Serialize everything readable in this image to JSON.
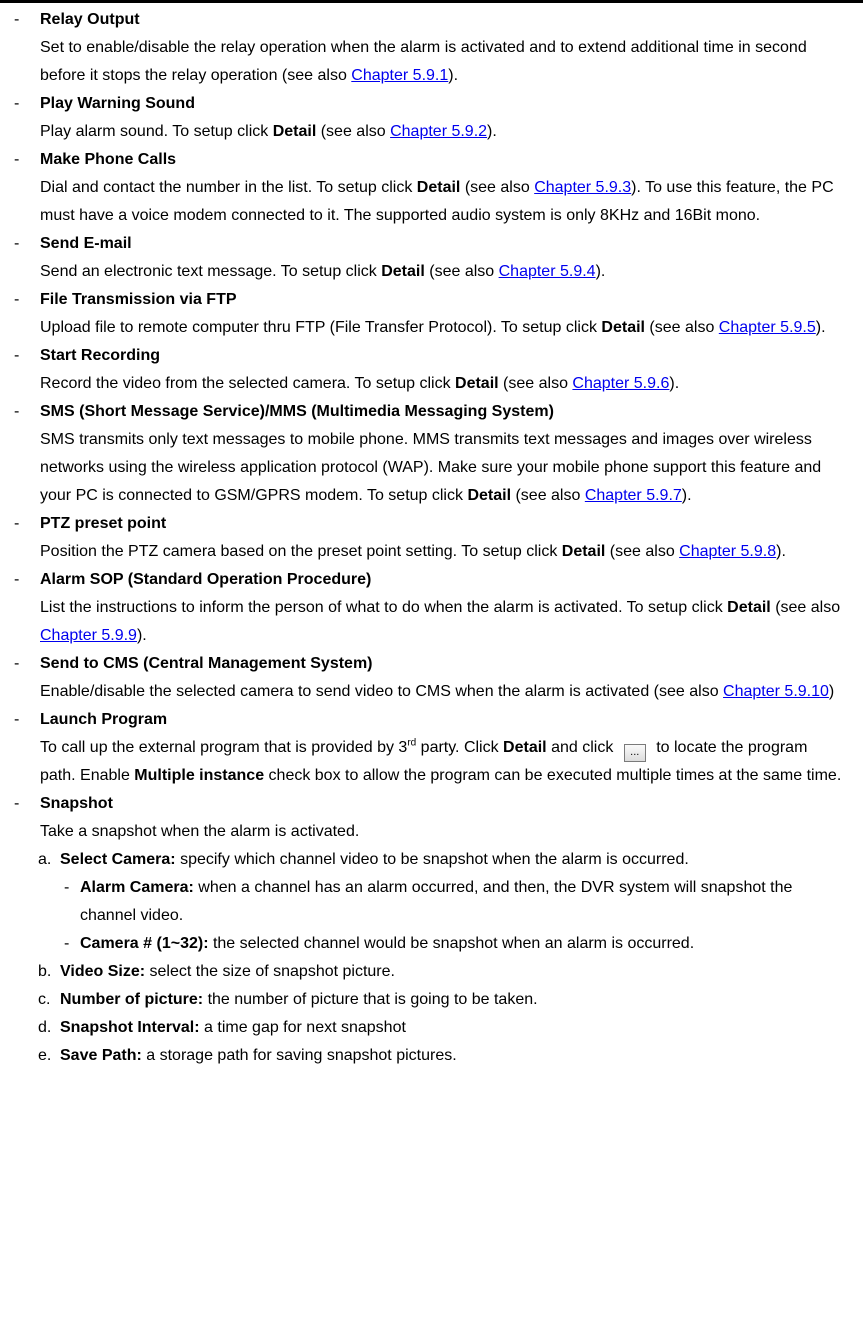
{
  "items": {
    "relay": {
      "title": "Relay Output",
      "t1": "Set to enable/disable the relay operation when the alarm is activated and to extend additional time in second before it stops the relay operation (see also ",
      "link": "Chapter 5.9.1",
      "t2": ")."
    },
    "sound": {
      "title": "Play Warning Sound",
      "t1": "Play alarm sound. To setup click ",
      "detail": "Detail",
      "t2": " (see also ",
      "link": "Chapter 5.9.2",
      "t3": ")."
    },
    "phone": {
      "title": "Make Phone Calls",
      "t1": "Dial and contact the number in the list. To setup click ",
      "detail": "Detail",
      "t2": " (see also ",
      "link": "Chapter 5.9.3",
      "t3": "). To use this feature, the PC must have a voice modem connected to it. The supported audio system is only 8KHz and 16Bit mono."
    },
    "email": {
      "title": "Send E-mail",
      "t1": "Send an electronic text message. To setup click ",
      "detail": "Detail",
      "t2": " (see also ",
      "link": "Chapter 5.9.4",
      "t3": ")."
    },
    "ftp": {
      "title": "File Transmission via FTP",
      "t1": "Upload file to remote computer thru FTP (File Transfer Protocol). To setup click ",
      "detail": "Detail",
      "t2": " (see also ",
      "link": "Chapter 5.9.5",
      "t3": ")."
    },
    "rec": {
      "title": "Start Recording",
      "t1": "Record the video from the selected camera. To setup click ",
      "detail": "Detail",
      "t2": " (see also ",
      "link": "Chapter 5.9.6",
      "t3": ")."
    },
    "sms": {
      "title": "SMS (Short Message Service)/MMS (Multimedia Messaging System)",
      "t1": "SMS transmits only text messages to mobile phone. MMS transmits text messages and images over wireless networks using the wireless application protocol (WAP). Make sure your mobile phone support this feature and your PC is connected to GSM/GPRS modem. To setup click ",
      "detail": "Detail",
      "t2": " (see also ",
      "link": "Chapter 5.9.7",
      "t3": ")."
    },
    "ptz": {
      "title": "PTZ preset point",
      "t1": "Position the PTZ camera based on the preset point setting. To setup click ",
      "detail": "Detail",
      "t2": " (see also ",
      "link": "Chapter 5.9.8",
      "t3": ")."
    },
    "sop": {
      "title": "Alarm SOP (Standard Operation Procedure)",
      "t1": "List the instructions to inform the person of what to do when the alarm is activated. To setup click ",
      "detail": "Detail",
      "t2": " (see also ",
      "link": "Chapter 5.9.9",
      "t3": ")."
    },
    "cms": {
      "title": "Send to CMS (Central Management System)",
      "t1": "Enable/disable the selected camera to send video to CMS when the alarm is activated (see also ",
      "link": "Chapter 5.9.10",
      "t2": ")"
    },
    "launch": {
      "title": "Launch Program",
      "t1": "To call up the external program that is provided by 3",
      "sup": "rd",
      "t2": " party. Click ",
      "detail": "Detail",
      "t3": " and click ",
      "btn": "...",
      "t4": " to locate the program path. Enable ",
      "multi": "Multiple instance",
      "t5": " check box to allow the program can be executed multiple times at the same time."
    },
    "snap": {
      "title": "Snapshot",
      "t1": "Take a snapshot when the alarm is activated.",
      "a": {
        "lbl": "a.",
        "bold": "Select Camera:",
        "text": " specify which channel video to be snapshot when the alarm is occurred."
      },
      "a1": {
        "bold": "Alarm Camera:",
        "text": " when a channel has an alarm occurred, and then, the DVR system will snapshot the channel video."
      },
      "a2": {
        "bold": "Camera # (1~32):",
        "text": " the selected channel would be snapshot when an alarm is occurred."
      },
      "b": {
        "lbl": "b.",
        "bold": "Video Size:",
        "text": " select the size of snapshot picture."
      },
      "c": {
        "lbl": "c.",
        "bold": "Number of picture:",
        "text": " the number of picture that is going to be taken."
      },
      "d": {
        "lbl": "d.",
        "bold": "Snapshot Interval:",
        "text": " a time gap for next snapshot"
      },
      "e": {
        "lbl": "e.",
        "bold": "Save Path:",
        "text": " a storage path for saving snapshot pictures."
      }
    }
  }
}
